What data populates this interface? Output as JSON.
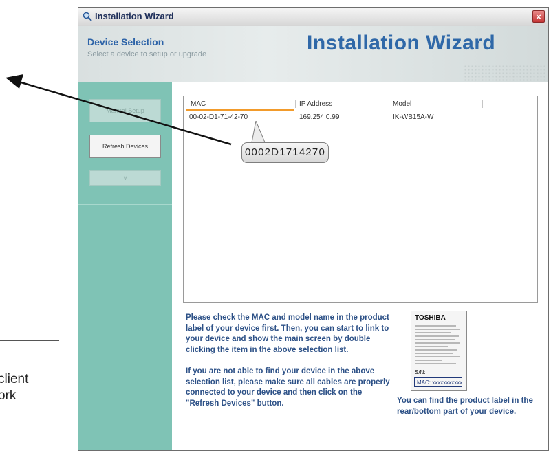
{
  "outside": {
    "line1": "client",
    "line2": "ork"
  },
  "window": {
    "title": "Installation Wizard",
    "close_glyph": "×"
  },
  "header": {
    "title": "Device Selection",
    "subtitle": "Select a device to setup or upgrade",
    "banner": "Installation Wizard"
  },
  "sidebar": {
    "manual_setup": "Manual Setup",
    "refresh_devices": "Refresh Devices",
    "third_button_glyph": "∨"
  },
  "device_list": {
    "columns": [
      "MAC",
      "IP Address",
      "Model"
    ],
    "rows": [
      [
        "00-02-D1-71-42-70",
        "169.254.0.99",
        "IK-WB15A-W"
      ]
    ]
  },
  "callout": {
    "text": "0002D1714270"
  },
  "instructions": {
    "p1": "Please check the MAC and model name in the product label of your device first. Then, you can start to link to your device and show the main screen by double clicking the item in the above selection list.",
    "p2": "If you are not able to find your device in the above selection list, please make sure all cables are properly connected to your device and then click on the \"Refresh Devices\" button."
  },
  "product_label": {
    "brand": "TOSHIBA",
    "sn_label": "S/N:",
    "mac_label": "MAC: xxxxxxxxxxxx",
    "caption": "You can find the product label in the rear/bottom part of your device."
  },
  "colors": {
    "accent_blue": "#2f68a8",
    "teal_panel": "#7fc3b5",
    "orange_underline": "#f29b2b",
    "instruction_text": "#2d5187"
  }
}
